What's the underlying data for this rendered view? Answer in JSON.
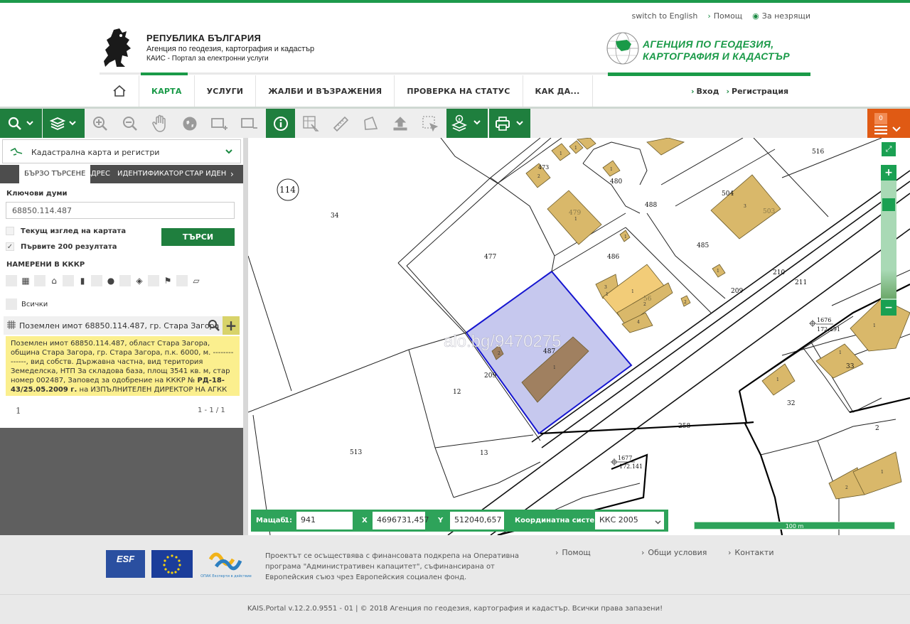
{
  "header": {
    "util_links": [
      "switch to English",
      "Помощ",
      "За незрящи"
    ],
    "brand_title": "РЕПУБЛИКА БЪЛГАРИЯ",
    "brand_subtitle": "Агенция по геодезия, картография и кадастър",
    "brand_portal": "КАИС - Портал за електронни услуги",
    "agency_line1": "АГЕНЦИЯ ПО ГЕОДЕЗИЯ,",
    "agency_line2": "КАРТОГРАФИЯ И КАДАСТЪР"
  },
  "nav": {
    "items": [
      "КАРТА",
      "УСЛУГИ",
      "ЖАЛБИ И ВЪЗРАЖЕНИЯ",
      "ПРОВЕРКА НА СТАТУС",
      "КАК ДА..."
    ],
    "active": "КАРТА",
    "login": "Вход",
    "register": "Регистрация"
  },
  "toolbar": {
    "cart_count": "0",
    "colors": {
      "green": "#1f7f3e",
      "orange": "#e05a14"
    }
  },
  "panel": {
    "layer": "Кадастрална карта и регистри",
    "tabs": [
      "БЪРЗО ТЪРСЕНЕ",
      "АДРЕС",
      "ИДЕНТИФИКАТОР",
      "СТАР ИДЕН"
    ],
    "keywords_label": "Ключови думи",
    "keywords_value": "68850.114.487",
    "cb_current_view": "Текущ изглед на картата",
    "cb_first_200": "Първите 200 резултата",
    "search_button": "ТЪРСИ",
    "found_label": "НАМЕРЕНИ В КККР",
    "all_label": "Всички",
    "result_title": "Поземлен имот 68850.114.487, гр. Стара Загора",
    "result_body_pre": "Поземлен имот 68850.114.487, област Стара Загора, община Стара Загора, гр. Стара Загора, п.к. 6000, м. --------------, вид собств. Държавна частна, вид територия Земеделска, НТП За складова база, площ 3541 кв. м, стар номер 002487, Заповед за одобрение на КККР №",
    "result_body_bold": "РД-18-43/25.05.2009 г.",
    "result_body_post": "на ИЗПЪЛНИТЕЛЕН ДИРЕКТОР НА АГКК",
    "page": "1",
    "count": "1 - 1 / 1"
  },
  "map": {
    "watermark": "alo.bg/9470275",
    "labels": [
      "114",
      "34",
      "477",
      "487",
      "209",
      "12",
      "13",
      "513",
      "258",
      "486",
      "485",
      "480",
      "488",
      "479",
      "504",
      "503",
      "516",
      "210",
      "211",
      "33",
      "32",
      "2",
      "1676",
      "172.491",
      "1677",
      "172.141",
      "473",
      "56"
    ],
    "scale_label": "Мащаб",
    "scale_prefix": "1:",
    "scale_value": "941",
    "x_label": "X",
    "x_value": "4696731,457",
    "y_label": "Y",
    "y_value": "512040,657",
    "crs_label": "Координатна система",
    "crs_value": "ККС 2005",
    "scalebar": "100 m"
  },
  "footer": {
    "project_text": "Проектът се осъществява с финансовата подкрепа на Оперативна програма \"Административен капацитет\", съфинансирана от Европейския съюз чрез Европейския социален фонд.",
    "links": [
      "Помощ",
      "Общи условия",
      "Контакти"
    ],
    "copyright": "KAIS.Portal v.12.2.0.9551 - 01  |  © 2018 Агенция по геодезия, картография и кадастър. Всички права запазени!",
    "logo_esf": "ESF",
    "logo_opak": "ОПАК Експерти в действие"
  }
}
